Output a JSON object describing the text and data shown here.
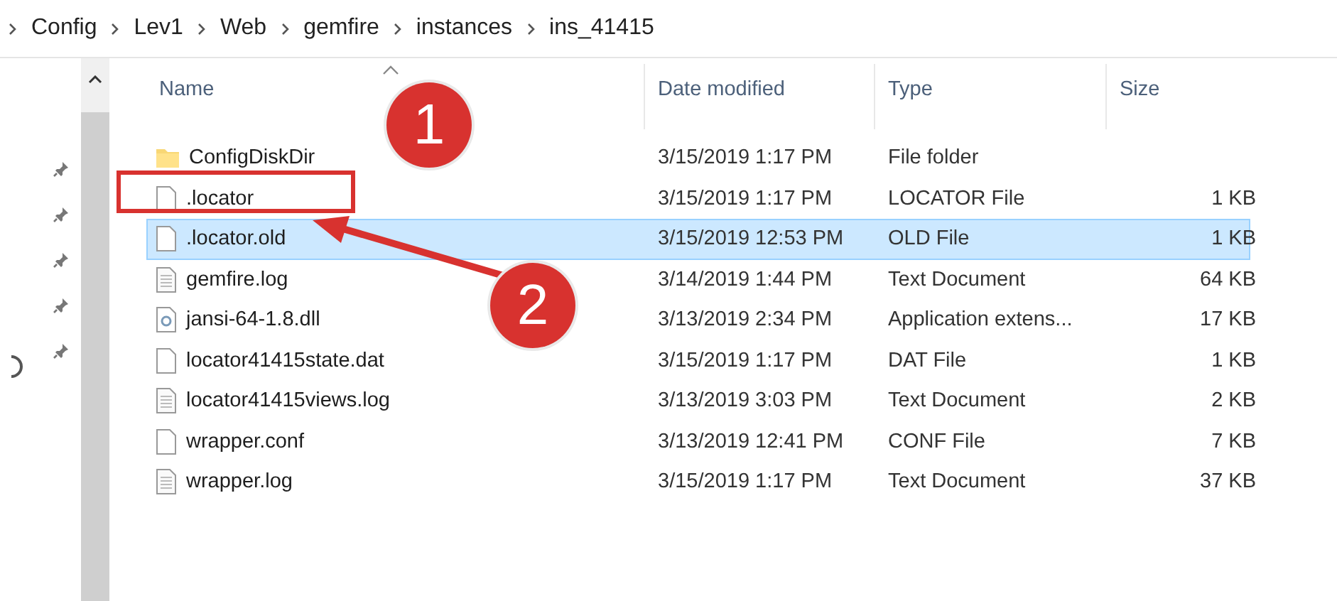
{
  "breadcrumb": [
    "Config",
    "Lev1",
    "Web",
    "gemfire",
    "instances",
    "ins_41415"
  ],
  "columns": [
    "Name",
    "Date modified",
    "Type",
    "Size"
  ],
  "rows": [
    {
      "kind": "folder",
      "name": "ConfigDiskDir",
      "date": "3/15/2019 1:17 PM",
      "type": "File folder",
      "selected": false
    },
    {
      "kind": "blank",
      "name": ".locator",
      "date": "3/15/2019 1:17 PM",
      "type": "LOCATOR File",
      "size": "1 KB",
      "selected": false
    },
    {
      "kind": "blank",
      "name": ".locator.old",
      "date": "3/15/2019 12:53 PM",
      "type": "OLD File",
      "size": "1 KB",
      "selected": true
    },
    {
      "kind": "text",
      "name": "gemfire.log",
      "date": "3/14/2019 1:44 PM",
      "type": "Text Document",
      "size": "64 KB",
      "selected": false
    },
    {
      "kind": "app",
      "name": "jansi-64-1.8.dll",
      "date": "3/13/2019 2:34 PM",
      "type": "Application extens...",
      "size": "17 KB",
      "selected": false
    },
    {
      "kind": "blank",
      "name": "locator41415state.dat",
      "date": "3/15/2019 1:17 PM",
      "type": "DAT File",
      "size": "1 KB",
      "selected": false
    },
    {
      "kind": "text",
      "name": "locator41415views.log",
      "date": "3/13/2019 3:03 PM",
      "type": "Text Document",
      "size": "2 KB",
      "selected": false
    },
    {
      "kind": "blank",
      "name": "wrapper.conf",
      "date": "3/13/2019 12:41 PM",
      "type": "CONF File",
      "size": "7 KB",
      "selected": false
    },
    {
      "kind": "text",
      "name": "wrapper.log",
      "date": "3/15/2019 1:17 PM",
      "type": "Text Document",
      "size": "37 KB",
      "selected": false
    }
  ],
  "annotations": [
    {
      "label": "1"
    },
    {
      "label": "2"
    }
  ]
}
